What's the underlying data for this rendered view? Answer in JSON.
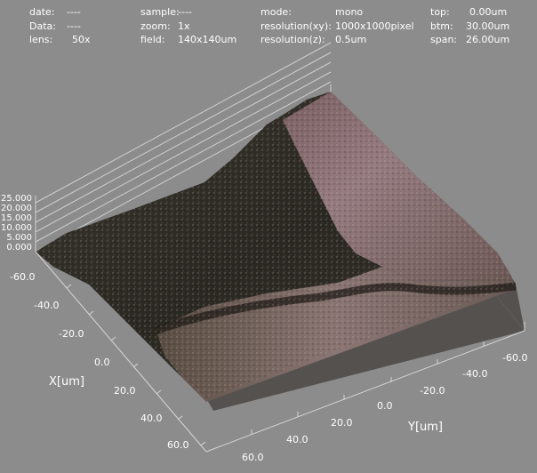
{
  "header": {
    "date_label": "date:",
    "date_value": "----",
    "data_label": "Data:",
    "data_value": "----",
    "lens_label": "lens:",
    "lens_value": "50x",
    "sample_label": "sample:",
    "sample_value": "----",
    "zoom_label": "zoom:",
    "zoom_value": "1x",
    "field_label": "field:",
    "field_value": "140x140um",
    "mode_label": "mode:",
    "mode_value": "mono",
    "resxy_label": "resolution(xy):",
    "resxy_value": "1000x1000pixel",
    "resz_label": "resolution(z):",
    "resz_value": "0.5um",
    "top_label": "top:",
    "top_value": "0.00um",
    "btm_label": "btm:",
    "btm_value": "30.00um",
    "span_label": "span:",
    "span_value": "26.00um"
  },
  "axes": {
    "z_ticks": [
      "25.000",
      "20.000",
      "15.000",
      "10.000",
      "5.000",
      "0.000"
    ],
    "x_title": "X[um]",
    "x_ticks": [
      "-60.0",
      "-40.0",
      "-20.0",
      "0.0",
      "20.0",
      "40.0",
      "60.0"
    ],
    "y_title": "Y[um]",
    "y_ticks": [
      "60.0",
      "40.0",
      "20.0",
      "0.0",
      "-20.0",
      "-40.0",
      "-60.0"
    ]
  },
  "colors": {
    "background": "#8c8c8c",
    "surface_dark": "#2f2c27",
    "surface_mid": "#4a4037",
    "surface_pink": "#8a6d6e",
    "surface_light": "#a58c90",
    "wall": "#4d4a47"
  }
}
